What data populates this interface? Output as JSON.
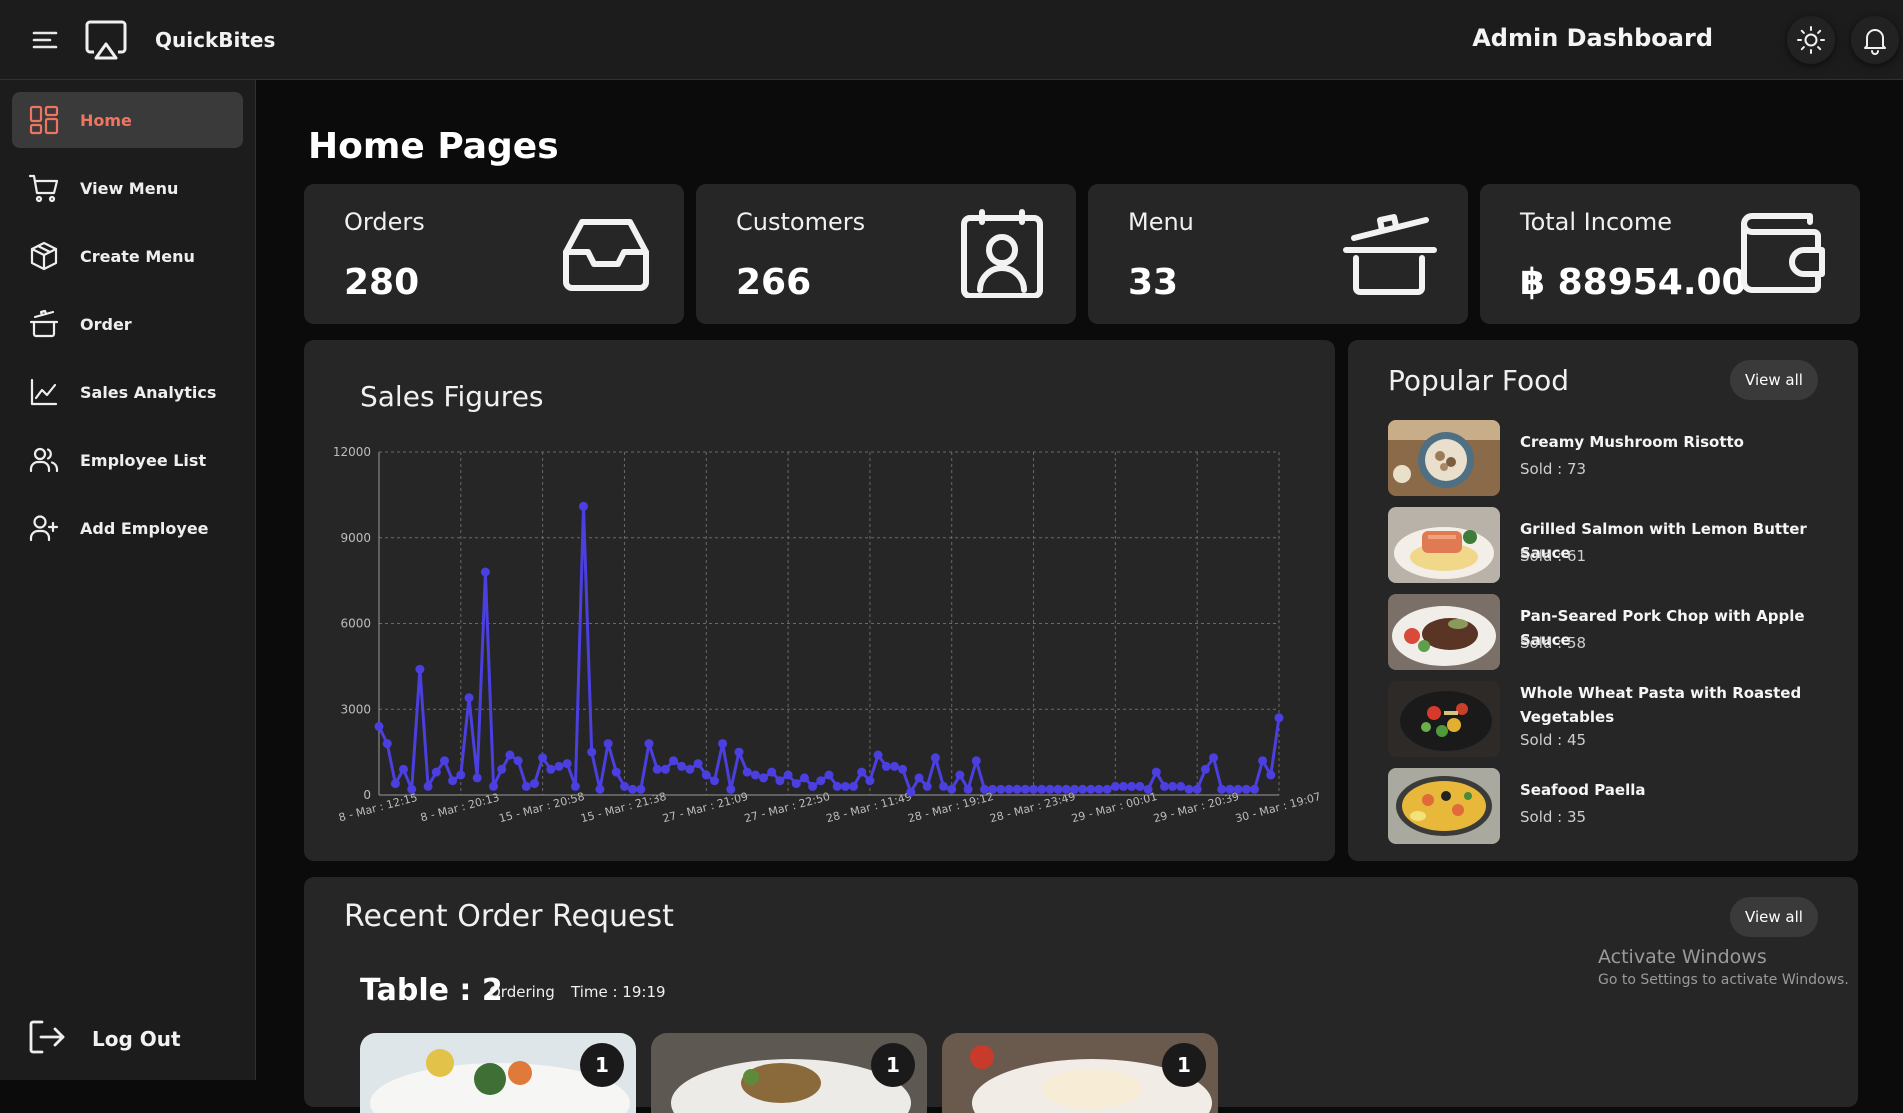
{
  "header": {
    "app_name": "QuickBites",
    "title": "Admin Dashboard",
    "menu_icon": "hamburger-icon",
    "logo_icon": "airplay-icon",
    "theme_icon": "sun-icon",
    "notification_icon": "bell-icon"
  },
  "sidebar": {
    "items": [
      {
        "label": "Home",
        "icon": "grid-icon",
        "active": true
      },
      {
        "label": "View Menu",
        "icon": "cart-icon"
      },
      {
        "label": "Create Menu",
        "icon": "package-icon"
      },
      {
        "label": "Order",
        "icon": "cooking-pot-icon"
      },
      {
        "label": "Sales Analytics",
        "icon": "line-chart-icon"
      },
      {
        "label": "Employee List",
        "icon": "users-icon"
      },
      {
        "label": "Add Employee",
        "icon": "user-plus-icon"
      }
    ],
    "logout_label": "Log Out"
  },
  "page": {
    "title": "Home Pages"
  },
  "stats": [
    {
      "label": "Orders",
      "value": "280",
      "icon": "inbox-icon"
    },
    {
      "label": "Customers",
      "value": "266",
      "icon": "contact-icon"
    },
    {
      "label": "Menu",
      "value": "33",
      "icon": "cooking-pot-icon"
    },
    {
      "label": "Total Income",
      "value": "฿ 88954.00",
      "icon": "wallet-icon"
    }
  ],
  "sales": {
    "title": "Sales Figures"
  },
  "chart_data": {
    "type": "line",
    "ylim": [
      0,
      12000
    ],
    "y_ticks": [
      "0",
      "3000",
      "6000",
      "9000",
      "12000"
    ],
    "x_tick_labels": [
      "8 - Mar : 12:15",
      "8 - Mar : 20:13",
      "15 - Mar : 20:58",
      "15 - Mar : 21:38",
      "27 - Mar : 21:09",
      "27 - Mar : 22:50",
      "28 - Mar : 11:49",
      "28 - Mar : 19:12",
      "28 - Mar : 23:49",
      "29 - Mar : 00:01",
      "29 - Mar : 20:39",
      "30 - Mar : 19:07"
    ],
    "grid": true,
    "color": "#4b3fe0",
    "values": [
      2400,
      1800,
      400,
      900,
      200,
      4400,
      300,
      800,
      1200,
      500,
      700,
      3400,
      600,
      7800,
      300,
      900,
      1400,
      1200,
      300,
      400,
      1300,
      900,
      1000,
      1100,
      300,
      10100,
      1500,
      200,
      1800,
      800,
      300,
      200,
      200,
      1800,
      900,
      900,
      1200,
      1000,
      900,
      1100,
      700,
      500,
      1800,
      200,
      1500,
      800,
      700,
      600,
      800,
      500,
      700,
      400,
      600,
      300,
      500,
      700,
      300,
      300,
      300,
      800,
      500,
      1400,
      1000,
      1000,
      900,
      100,
      600,
      300,
      1300,
      300,
      200,
      700,
      200,
      1200,
      200,
      200,
      200,
      200,
      200,
      200,
      200,
      200,
      200,
      200,
      200,
      200,
      200,
      200,
      200,
      200,
      300,
      300,
      300,
      300,
      200,
      800,
      300,
      300,
      300,
      200,
      200,
      900,
      1300,
      200,
      200,
      200,
      200,
      200,
      1200,
      700,
      2700
    ]
  },
  "popular": {
    "title": "Popular Food",
    "view_all": "View all",
    "items": [
      {
        "name": "Creamy Mushroom Risotto",
        "sold": "Sold : 73"
      },
      {
        "name": "Grilled Salmon with Lemon Butter Sauce",
        "sold": "Sold : 61"
      },
      {
        "name": "Pan-Seared Pork Chop with Apple Sauce",
        "sold": "Sold : 58"
      },
      {
        "name": "Whole Wheat Pasta with Roasted Vegetables",
        "sold": "Sold : 45"
      },
      {
        "name": "Seafood Paella",
        "sold": "Sold : 35"
      }
    ]
  },
  "recent": {
    "title": "Recent Order Request",
    "view_all": "View all",
    "table": "Table : 2",
    "status": "Ordering",
    "time": "Time : 19:19",
    "items": [
      {
        "quantity": "1"
      },
      {
        "quantity": "1"
      },
      {
        "quantity": "1"
      }
    ]
  },
  "watermark": {
    "line1": "Activate Windows",
    "line2": "Go to Settings to activate Windows."
  },
  "colors": {
    "accent": "#f07561",
    "chart_line": "#4b3fe0",
    "panel": "#262626",
    "background": "#0b0b0b"
  }
}
